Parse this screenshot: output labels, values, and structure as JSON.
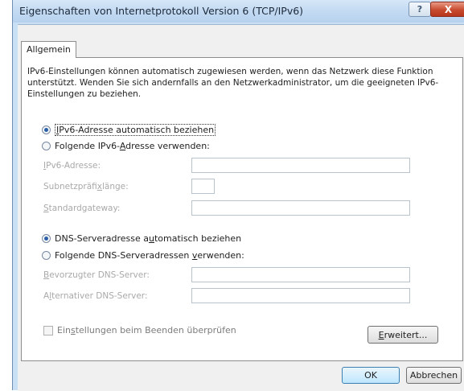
{
  "window": {
    "title": "Eigenschaften von Internetprotokoll Version 6 (TCP/IPv6)",
    "help_label": "?",
    "close_label": "X"
  },
  "tabs": [
    {
      "label": "Allgemein",
      "active": true
    }
  ],
  "description": "IPv6-Einstellungen können automatisch zugewiesen werden, wenn das Netzwerk diese Funktion unterstützt. Wenden Sie sich andernfalls an den Netzwerkadministrator, um die geeigneten IPv6-Einstellungen zu beziehen.",
  "ip": {
    "auto_label_a": "I",
    "auto_label_b": "Pv6-Adresse automatisch beziehen",
    "auto_selected": true,
    "manual_label_a": "Folgende IPv6-",
    "manual_label_u": "A",
    "manual_label_b": "dresse verwenden:",
    "manual_selected": false,
    "fields": [
      {
        "label_a": "",
        "label_u": "I",
        "label_b": "Pv6-Adresse:",
        "value": ""
      },
      {
        "label_a": "Subnetzpräfi",
        "label_u": "x",
        "label_b": "länge:",
        "value": ""
      },
      {
        "label_a": "",
        "label_u": "S",
        "label_b": "tandardgateway:",
        "value": ""
      }
    ]
  },
  "dns": {
    "auto_label_a": "DNS-Serveradresse a",
    "auto_label_u": "u",
    "auto_label_b": "tomatisch beziehen",
    "auto_selected": true,
    "manual_label_a": "Folgende DNS-Serveradressen ",
    "manual_label_u": "v",
    "manual_label_b": "erwenden:",
    "manual_selected": false,
    "fields": [
      {
        "label_a": "",
        "label_u": "B",
        "label_b": "evorzugter DNS-Server:",
        "value": ""
      },
      {
        "label_a": "A",
        "label_u": "l",
        "label_b": "ternativer DNS-Server:",
        "value": ""
      }
    ]
  },
  "validate": {
    "label_a": "Ein",
    "label_u": "s",
    "label_b": "tellungen beim Beenden überprüfen",
    "checked": false
  },
  "advanced_button": {
    "label_u": "E",
    "label_b": "rweitert..."
  },
  "footer": {
    "ok_label": "OK",
    "cancel_label": "Abbrechen"
  }
}
